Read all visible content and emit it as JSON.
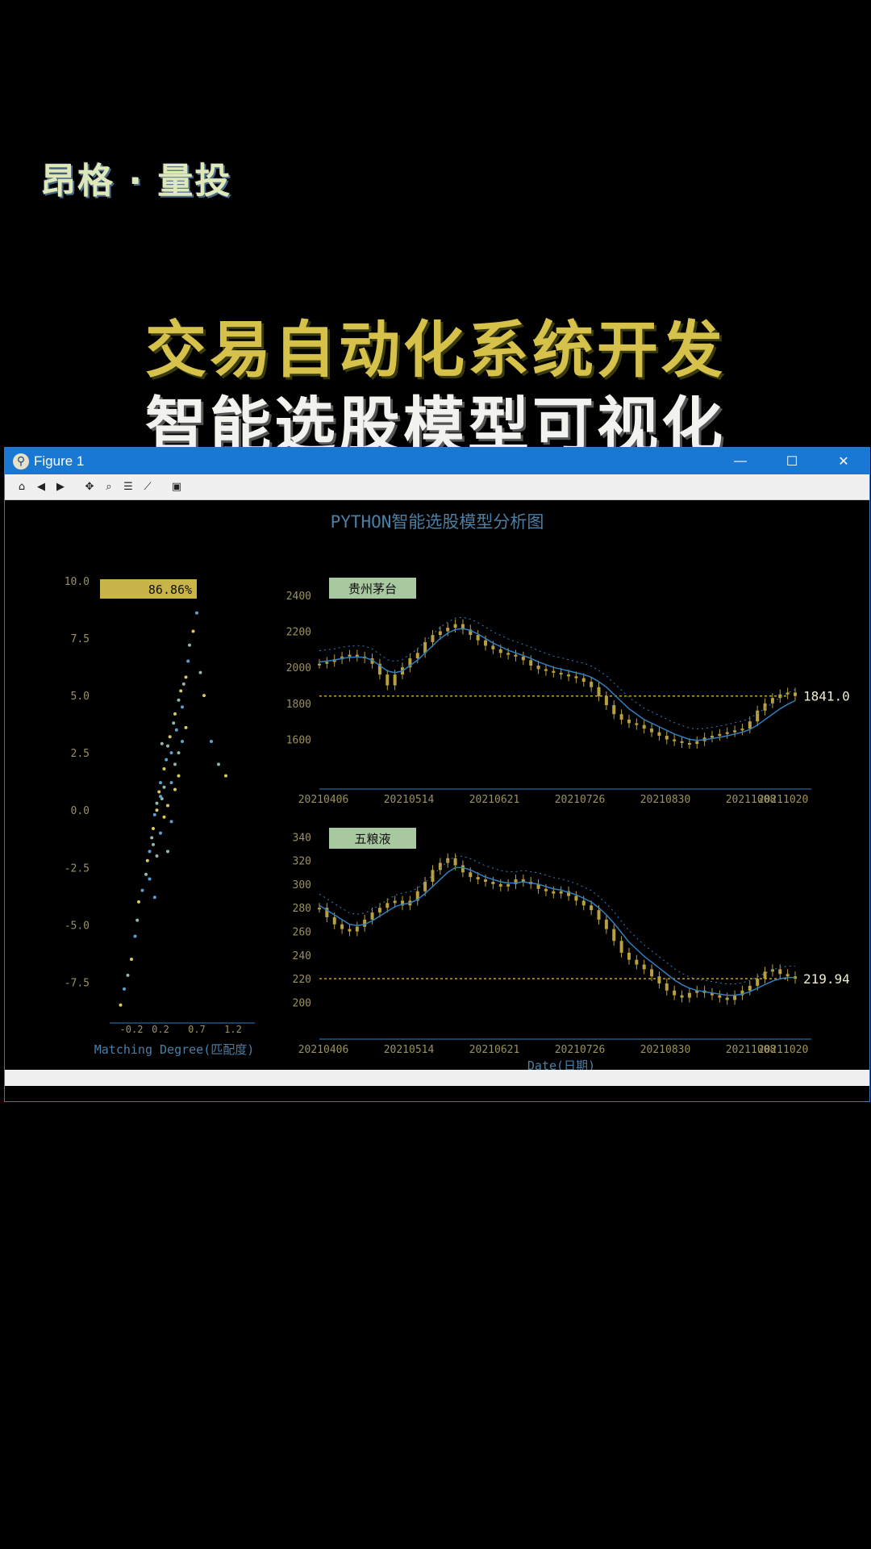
{
  "brand": "昂格 · 量投",
  "headline": {
    "line1": "交易自动化系统开发",
    "line2": "智能选股模型可视化"
  },
  "window": {
    "title": "Figure 1",
    "controls": {
      "minimize": "—",
      "maximize": "☐",
      "close": "✕"
    }
  },
  "toolbar": {
    "icons": [
      "home-icon",
      "back-arrow-icon",
      "forward-arrow-icon",
      "pan-icon",
      "zoom-icon",
      "configure-subplots-icon",
      "edit-axis-icon",
      "save-icon"
    ]
  },
  "colors": {
    "accent": "#1978d4",
    "title_text": "#4a7fa6",
    "candle": "#b8a040",
    "ma": "#2f7fc0",
    "badge_gold": "#c8b448",
    "badge_green": "#a8c8a0"
  },
  "figure_title": "PYTHON智能选股模型分析图",
  "chart_data": [
    {
      "type": "scatter",
      "badge": "86.86%",
      "xlabel": "Matching Degree(匹配度)",
      "yticks": [
        "10.0",
        "7.5",
        "5.0",
        "2.5",
        "0.0",
        "-2.5",
        "-5.0",
        "-7.5"
      ],
      "xticks": [
        "-0.2",
        "0.2",
        "0.7",
        "1.2"
      ],
      "ylim": [
        -9,
        10
      ],
      "xlim": [
        -0.5,
        1.5
      ],
      "x": [
        -0.35,
        -0.3,
        -0.25,
        -0.2,
        -0.15,
        -0.12,
        -0.1,
        -0.05,
        0.0,
        0.02,
        0.05,
        0.08,
        0.1,
        0.12,
        0.15,
        0.18,
        0.2,
        0.22,
        0.25,
        0.28,
        0.3,
        0.33,
        0.35,
        0.38,
        0.4,
        0.42,
        0.45,
        0.48,
        0.5,
        0.52,
        0.55,
        0.58,
        0.6,
        0.65,
        0.7,
        0.75,
        0.8,
        0.9,
        1.0,
        1.1,
        0.05,
        0.1,
        0.15,
        0.2,
        0.25,
        0.3,
        0.35,
        0.4,
        0.45,
        0.5,
        0.15,
        0.25,
        0.35,
        0.45,
        0.55,
        0.2,
        0.3,
        0.4,
        0.12,
        0.22
      ],
      "y": [
        -8.5,
        -7.8,
        -7.2,
        -6.5,
        -5.5,
        -4.8,
        -4.0,
        -3.5,
        -2.8,
        -2.2,
        -1.8,
        -1.2,
        -0.8,
        -0.2,
        0.3,
        0.8,
        1.2,
        0.5,
        1.8,
        2.2,
        2.8,
        3.2,
        2.5,
        3.8,
        4.2,
        3.5,
        4.8,
        5.2,
        4.5,
        5.5,
        5.8,
        6.5,
        7.2,
        7.8,
        8.6,
        6.0,
        5.0,
        3.0,
        2.0,
        1.5,
        -3.0,
        -1.5,
        0.0,
        -1.0,
        1.0,
        0.2,
        -0.5,
        2.0,
        1.5,
        3.0,
        -2.0,
        -0.3,
        1.2,
        2.5,
        3.6,
        0.6,
        -1.8,
        0.9,
        -3.8,
        2.9
      ]
    },
    {
      "type": "line",
      "name": "贵州茅台",
      "last_value": "1841.0",
      "yticks": [
        "2400",
        "2200",
        "2000",
        "1800",
        "1600"
      ],
      "xticks": [
        "20210406",
        "20210514",
        "20210621",
        "20210726",
        "20210830",
        "20211008",
        "20211020"
      ],
      "ylim": [
        1450,
        2480
      ],
      "close": [
        2020,
        2030,
        2045,
        2060,
        2070,
        2060,
        2050,
        2020,
        1960,
        1900,
        1960,
        2000,
        2050,
        2080,
        2140,
        2180,
        2200,
        2220,
        2240,
        2210,
        2180,
        2150,
        2120,
        2100,
        2080,
        2070,
        2060,
        2040,
        2010,
        1990,
        1980,
        1970,
        1960,
        1950,
        1940,
        1920,
        1890,
        1840,
        1790,
        1740,
        1710,
        1690,
        1680,
        1660,
        1640,
        1620,
        1600,
        1590,
        1580,
        1575,
        1590,
        1610,
        1620,
        1630,
        1640,
        1650,
        1660,
        1700,
        1760,
        1800,
        1830,
        1850,
        1860,
        1841
      ],
      "ma": [
        2030,
        2035,
        2040,
        2050,
        2055,
        2058,
        2055,
        2040,
        2010,
        1980,
        1970,
        1980,
        2010,
        2040,
        2080,
        2120,
        2160,
        2190,
        2210,
        2215,
        2205,
        2185,
        2160,
        2135,
        2115,
        2095,
        2080,
        2065,
        2050,
        2030,
        2015,
        2000,
        1990,
        1980,
        1970,
        1960,
        1945,
        1920,
        1890,
        1850,
        1810,
        1770,
        1740,
        1710,
        1690,
        1670,
        1650,
        1630,
        1615,
        1600,
        1595,
        1598,
        1605,
        1612,
        1620,
        1630,
        1640,
        1655,
        1680,
        1710,
        1740,
        1770,
        1795,
        1815
      ],
      "reference": 1841.0
    },
    {
      "type": "line",
      "name": "五粮液",
      "last_value": "219.94",
      "yticks": [
        "340",
        "320",
        "300",
        "280",
        "260",
        "240",
        "220",
        "200"
      ],
      "xticks": [
        "20210406",
        "20210514",
        "20210621",
        "20210726",
        "20210830",
        "20211008",
        "20211020"
      ],
      "ylim": [
        188,
        345
      ],
      "close": [
        280,
        272,
        266,
        262,
        260,
        264,
        270,
        276,
        280,
        284,
        286,
        282,
        286,
        294,
        302,
        312,
        318,
        322,
        316,
        310,
        306,
        304,
        302,
        300,
        298,
        300,
        304,
        302,
        300,
        296,
        294,
        292,
        294,
        290,
        286,
        282,
        278,
        270,
        262,
        252,
        242,
        236,
        232,
        228,
        222,
        216,
        210,
        206,
        204,
        208,
        210,
        208,
        206,
        204,
        202,
        206,
        210,
        214,
        220,
        226,
        228,
        224,
        222,
        219.94
      ],
      "ma": [
        282,
        278,
        274,
        270,
        266,
        265,
        266,
        269,
        273,
        277,
        281,
        283,
        284,
        287,
        292,
        298,
        304,
        310,
        314,
        314,
        312,
        309,
        306,
        304,
        302,
        301,
        301,
        302,
        301,
        300,
        298,
        296,
        295,
        293,
        291,
        288,
        285,
        280,
        274,
        267,
        259,
        251,
        245,
        239,
        234,
        229,
        224,
        219,
        215,
        212,
        210,
        209,
        208,
        207,
        206,
        206,
        207,
        209,
        212,
        215,
        218,
        220,
        221,
        221
      ],
      "reference": 220
    }
  ]
}
